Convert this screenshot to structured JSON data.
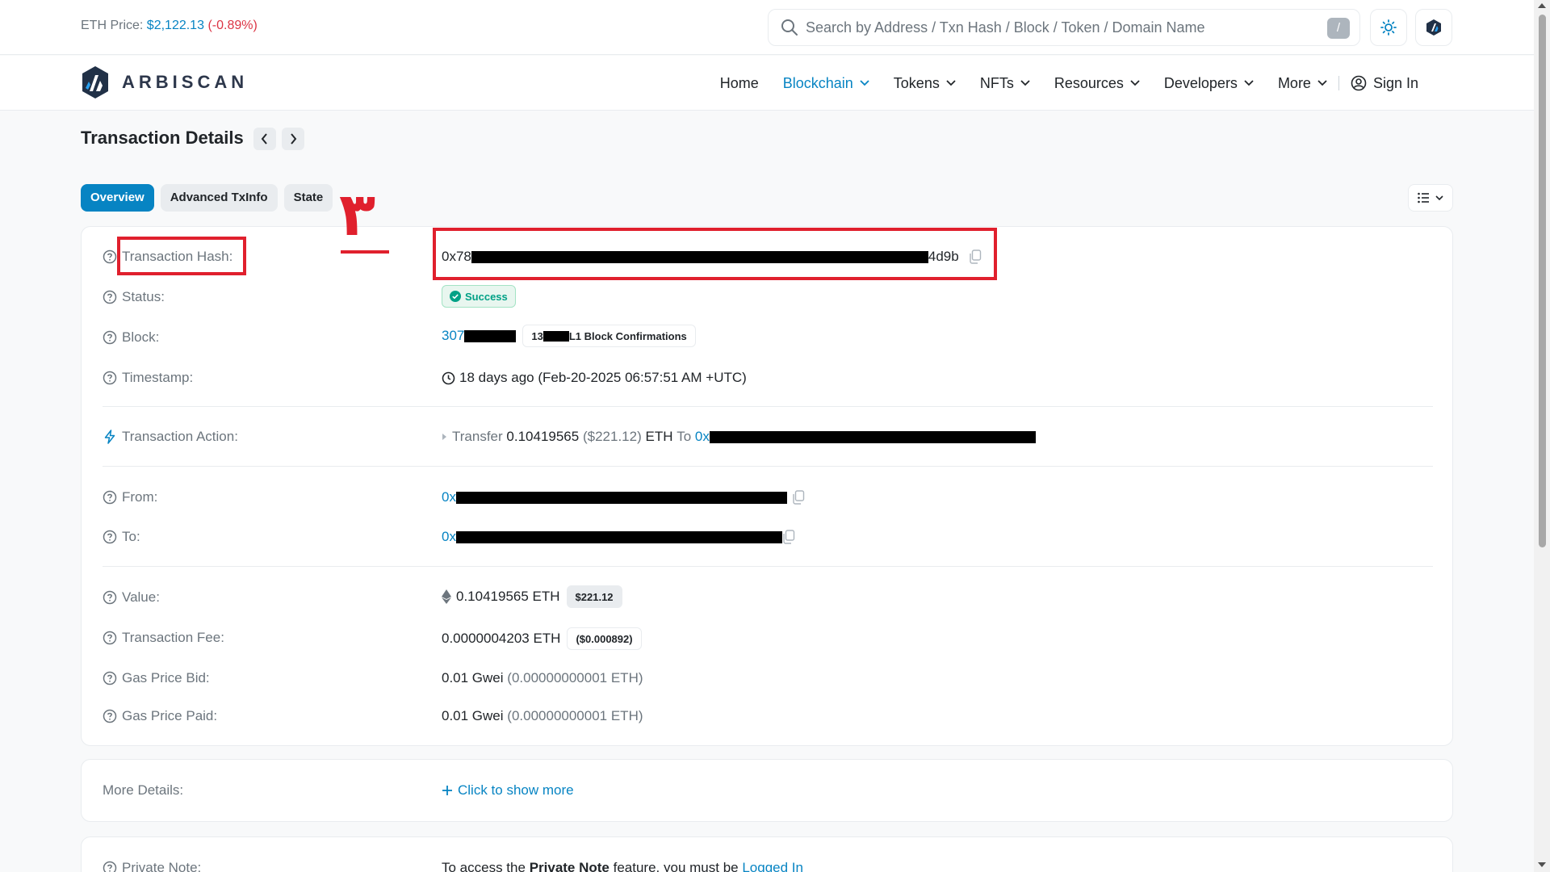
{
  "header": {
    "eth_price_label": "ETH Price:",
    "eth_price_value": "$2,122.13",
    "eth_price_change": "(-0.89%)",
    "search_placeholder": "Search by Address / Txn Hash / Block / Token / Domain Name",
    "search_shortcut": "/"
  },
  "brand": {
    "logo_text": "ARBISCAN"
  },
  "nav": {
    "items": [
      {
        "label": "Home",
        "dropdown": false
      },
      {
        "label": "Blockchain",
        "dropdown": true,
        "active": true
      },
      {
        "label": "Tokens",
        "dropdown": true
      },
      {
        "label": "NFTs",
        "dropdown": true
      },
      {
        "label": "Resources",
        "dropdown": true
      },
      {
        "label": "Developers",
        "dropdown": true
      },
      {
        "label": "More",
        "dropdown": true
      }
    ],
    "signin": "Sign In"
  },
  "page": {
    "title": "Transaction Details",
    "tabs": [
      "Overview",
      "Advanced TxInfo",
      "State"
    ]
  },
  "annotation": {
    "mark": "٣"
  },
  "details": {
    "tx_hash": {
      "label": "Transaction Hash:",
      "prefix": "0x78",
      "suffix": "4d9b"
    },
    "status": {
      "label": "Status:",
      "value": "Success"
    },
    "block": {
      "label": "Block:",
      "prefix": "307",
      "confirmations_prefix": "13",
      "confirmations_suffix": "L1 Block Confirmations"
    },
    "timestamp": {
      "label": "Timestamp:",
      "value": "18 days ago (Feb-20-2025 06:57:51 AM +UTC)"
    },
    "action": {
      "label": "Transaction Action:",
      "verb": "Transfer",
      "amount": "0.10419565",
      "usd": "($221.12)",
      "unit": "ETH",
      "to_word": "To",
      "to_prefix": "0x"
    },
    "from": {
      "label": "From:",
      "prefix": "0x"
    },
    "to": {
      "label": "To:",
      "prefix": "0x"
    },
    "value": {
      "label": "Value:",
      "amount": "0.10419565 ETH",
      "usd": "$221.12"
    },
    "fee": {
      "label": "Transaction Fee:",
      "amount": "0.0000004203 ETH",
      "usd": "($0.000892)"
    },
    "gas_bid": {
      "label": "Gas Price Bid:",
      "gwei": "0.01 Gwei",
      "eth": "(0.00000000001 ETH)"
    },
    "gas_paid": {
      "label": "Gas Price Paid:",
      "gwei": "0.01 Gwei",
      "eth": "(0.00000000001 ETH)"
    }
  },
  "more_details": {
    "label": "More Details:",
    "link": "Click to show more"
  },
  "private_note": {
    "label": "Private Note:",
    "text_before": "To access the",
    "bold": "Private Note",
    "text_mid": "feature, you must be",
    "link": "Logged In"
  },
  "colors": {
    "accent": "#0784c3",
    "negative": "#dc3545",
    "success": "#00a186",
    "annotation": "#e0202d"
  }
}
